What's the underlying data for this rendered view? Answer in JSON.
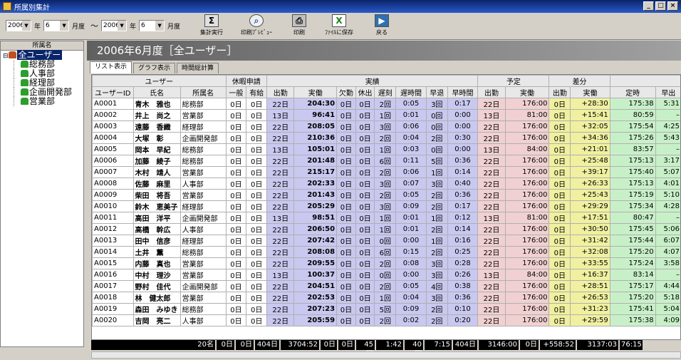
{
  "window": {
    "title": "所属別集計"
  },
  "toolbar": {
    "from_year": "2006",
    "year_label1": "年",
    "from_month": "6",
    "month_label1": "月度",
    "tilde": "〜",
    "to_year": "2006",
    "year_label2": "年",
    "to_month": "6",
    "month_label2": "月度",
    "buttons": [
      "集計実行",
      "印刷ﾌﾟﾚﾋﾞｭｰ",
      "印刷",
      "ﾌｧｲﾙに保存",
      "戻る"
    ]
  },
  "tree": {
    "header": "所属名",
    "root": "全ユーザー",
    "children": [
      "総務部",
      "人事部",
      "経理部",
      "企画開発部",
      "営業部"
    ]
  },
  "banner": "2006年6月度［全ユーザー］",
  "tabs": [
    "リスト表示",
    "グラフ表示",
    "時間総計算"
  ],
  "headers": {
    "group": [
      "ユーザー",
      "休暇申請",
      "実績",
      "予定",
      "差分"
    ],
    "cols": [
      "ユーザーID",
      "氏名",
      "所属名",
      "一般",
      "有給",
      "出勤",
      "実働",
      "欠勤",
      "休出",
      "遅刻",
      "遅時間",
      "早退",
      "早時間",
      "出勤",
      "実働",
      "出勤",
      "実働",
      "定時",
      "早出"
    ]
  },
  "rows": [
    [
      "A0001",
      "青木　雅也",
      "総務部",
      "0日",
      "0日",
      "22日",
      "204:30",
      "0日",
      "0日",
      "2回",
      "0:05",
      "3回",
      "0:17",
      "22日",
      "176:00",
      "0日",
      "+28:30",
      "175:38",
      "5:31"
    ],
    [
      "A0002",
      "井上　尚之",
      "営業部",
      "0日",
      "0日",
      "13日",
      "96:41",
      "0日",
      "0日",
      "1回",
      "0:01",
      "0回",
      "0:00",
      "13日",
      "81:00",
      "0日",
      "+15:41",
      "80:59",
      "–"
    ],
    [
      "A0003",
      "遠藤　香織",
      "経理部",
      "0日",
      "0日",
      "22日",
      "208:05",
      "0日",
      "0日",
      "3回",
      "0:06",
      "0回",
      "0:00",
      "22日",
      "176:00",
      "0日",
      "+32:05",
      "175:54",
      "4:25"
    ],
    [
      "A0004",
      "大塚　彰",
      "企画開発部",
      "0日",
      "0日",
      "22日",
      "210:36",
      "0日",
      "0日",
      "2回",
      "0:04",
      "2回",
      "0:30",
      "22日",
      "176:00",
      "0日",
      "+34:36",
      "175:26",
      "5:43"
    ],
    [
      "A0005",
      "岡本　早紀",
      "総務部",
      "0日",
      "0日",
      "13日",
      "105:01",
      "0日",
      "0日",
      "1回",
      "0:03",
      "0回",
      "0:00",
      "13日",
      "84:00",
      "0日",
      "+21:01",
      "83:57",
      "–"
    ],
    [
      "A0006",
      "加藤　綾子",
      "総務部",
      "0日",
      "0日",
      "22日",
      "201:48",
      "0日",
      "0日",
      "6回",
      "0:11",
      "5回",
      "0:36",
      "22日",
      "176:00",
      "0日",
      "+25:48",
      "175:13",
      "3:17"
    ],
    [
      "A0007",
      "木村　靖人",
      "営業部",
      "0日",
      "0日",
      "22日",
      "215:17",
      "0日",
      "0日",
      "2回",
      "0:06",
      "1回",
      "0:14",
      "22日",
      "176:00",
      "0日",
      "+39:17",
      "175:40",
      "5:07"
    ],
    [
      "A0008",
      "佐藤　麻里",
      "人事部",
      "0日",
      "0日",
      "22日",
      "202:33",
      "0日",
      "0日",
      "3回",
      "0:07",
      "3回",
      "0:40",
      "22日",
      "176:00",
      "0日",
      "+26:33",
      "175:13",
      "4:01"
    ],
    [
      "A0009",
      "柴田　将吾",
      "営業部",
      "0日",
      "0日",
      "22日",
      "201:43",
      "0日",
      "0日",
      "2回",
      "0:05",
      "2回",
      "0:36",
      "22日",
      "176:00",
      "0日",
      "+25:43",
      "175:19",
      "5:10"
    ],
    [
      "A0010",
      "鈴木　恵美子",
      "経理部",
      "0日",
      "0日",
      "22日",
      "205:29",
      "0日",
      "0日",
      "3回",
      "0:09",
      "2回",
      "0:17",
      "22日",
      "176:00",
      "0日",
      "+29:29",
      "175:34",
      "4:28"
    ],
    [
      "A0011",
      "高田　洋平",
      "企画開発部",
      "0日",
      "0日",
      "13日",
      "98:51",
      "0日",
      "0日",
      "1回",
      "0:01",
      "1回",
      "0:12",
      "13日",
      "81:00",
      "0日",
      "+17:51",
      "80:47",
      "–"
    ],
    [
      "A0012",
      "高橋　幹広",
      "人事部",
      "0日",
      "0日",
      "22日",
      "206:50",
      "0日",
      "0日",
      "1回",
      "0:01",
      "2回",
      "0:14",
      "22日",
      "176:00",
      "0日",
      "+30:50",
      "175:45",
      "5:06"
    ],
    [
      "A0013",
      "田中　信彦",
      "経理部",
      "0日",
      "0日",
      "22日",
      "207:42",
      "0日",
      "0日",
      "0回",
      "0:00",
      "1回",
      "0:16",
      "22日",
      "176:00",
      "0日",
      "+31:42",
      "175:44",
      "6:07"
    ],
    [
      "A0014",
      "土井　薫",
      "総務部",
      "0日",
      "0日",
      "22日",
      "208:08",
      "0日",
      "0日",
      "6回",
      "0:15",
      "2回",
      "0:25",
      "22日",
      "176:00",
      "0日",
      "+32:08",
      "175:20",
      "4:07"
    ],
    [
      "A0015",
      "内藤　真也",
      "営業部",
      "0日",
      "0日",
      "22日",
      "209:55",
      "0日",
      "0日",
      "2回",
      "0:08",
      "3回",
      "0:28",
      "22日",
      "176:00",
      "0日",
      "+33:55",
      "175:24",
      "3:58"
    ],
    [
      "A0016",
      "中村　理沙",
      "営業部",
      "0日",
      "0日",
      "13日",
      "100:37",
      "0日",
      "0日",
      "0回",
      "0:00",
      "3回",
      "0:26",
      "13日",
      "84:00",
      "0日",
      "+16:37",
      "83:14",
      "–"
    ],
    [
      "A0017",
      "野村　佳代",
      "企画開発部",
      "0日",
      "0日",
      "22日",
      "204:51",
      "0日",
      "0日",
      "2回",
      "0:05",
      "4回",
      "0:38",
      "22日",
      "176:00",
      "0日",
      "+28:51",
      "175:17",
      "4:44"
    ],
    [
      "A0018",
      "林　健太郎",
      "営業部",
      "0日",
      "0日",
      "22日",
      "202:53",
      "0日",
      "0日",
      "1回",
      "0:04",
      "3回",
      "0:36",
      "22日",
      "176:00",
      "0日",
      "+26:53",
      "175:20",
      "5:18"
    ],
    [
      "A0019",
      "森田　みゆき",
      "総務部",
      "0日",
      "0日",
      "22日",
      "207:23",
      "0日",
      "0日",
      "5回",
      "0:09",
      "2回",
      "0:10",
      "22日",
      "176:00",
      "0日",
      "+31:23",
      "175:41",
      "5:04"
    ],
    [
      "A0020",
      "吉岡　亮二",
      "人事部",
      "0日",
      "0日",
      "22日",
      "205:59",
      "0日",
      "0日",
      "2回",
      "0:02",
      "2回",
      "0:20",
      "22日",
      "176:00",
      "0日",
      "+29:59",
      "175:38",
      "4:09"
    ]
  ],
  "footer": [
    "20名",
    "0日",
    "0日",
    "404日",
    "3704:52",
    "0日",
    "0日",
    "45回",
    "1:42",
    "40回",
    "7:15",
    "404日",
    "3146:00",
    "0日",
    "+558:52",
    "3137:03",
    "76:15"
  ]
}
